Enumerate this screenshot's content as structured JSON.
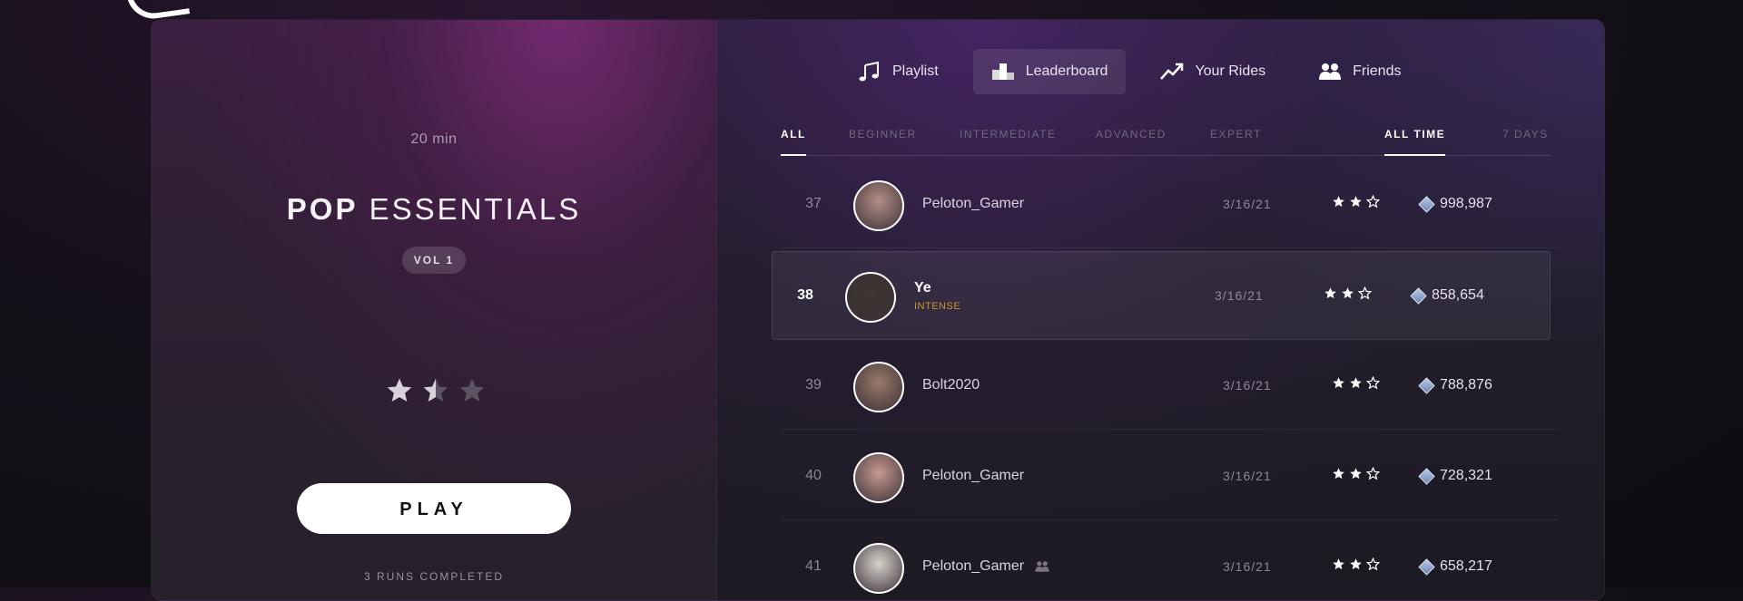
{
  "ride": {
    "duration": "20 min",
    "title_bold": "POP",
    "title_rest": "ESSENTIALS",
    "volume": "VOL 1",
    "difficulty_rating": 1.5,
    "difficulty_max": 3,
    "play_label": "PLAY",
    "runs_completed": "3 RUNS COMPLETED"
  },
  "tabs": [
    {
      "label": "Playlist",
      "icon": "music-note-icon",
      "active": false
    },
    {
      "label": "Leaderboard",
      "icon": "podium-icon",
      "active": true
    },
    {
      "label": "Your Rides",
      "icon": "trending-up-icon",
      "active": false
    },
    {
      "label": "Friends",
      "icon": "friends-icon",
      "active": false
    }
  ],
  "filters": {
    "levels": [
      "ALL",
      "BEGINNER",
      "INTERMEDIATE",
      "ADVANCED",
      "EXPERT"
    ],
    "active_level": "ALL",
    "periods": [
      "ALL TIME",
      "7 DAYS"
    ],
    "active_period": "ALL TIME"
  },
  "leaderboard": [
    {
      "rank": "37",
      "name": "Peloton_Gamer",
      "tag": "",
      "date": "3/16/21",
      "stars": 2,
      "score": "998,987",
      "highlight": false,
      "friend": false,
      "avatar_color": "#b58f86"
    },
    {
      "rank": "38",
      "name": "Ye",
      "tag": "INTENSE",
      "date": "3/16/21",
      "stars": 2,
      "score": "858,654",
      "highlight": true,
      "friend": false,
      "avatar_color": "#3e3530"
    },
    {
      "rank": "39",
      "name": "Bolt2020",
      "tag": "",
      "date": "3/16/21",
      "stars": 2,
      "score": "788,876",
      "highlight": false,
      "friend": false,
      "avatar_color": "#9a7a68"
    },
    {
      "rank": "40",
      "name": "Peloton_Gamer",
      "tag": "",
      "date": "3/16/21",
      "stars": 2,
      "score": "728,321",
      "highlight": false,
      "friend": false,
      "avatar_color": "#c79a8e"
    },
    {
      "rank": "41",
      "name": "Peloton_Gamer",
      "tag": "",
      "date": "3/16/21",
      "stars": 2,
      "score": "658,217",
      "highlight": false,
      "friend": true,
      "avatar_color": "#d8d2cc"
    }
  ],
  "colors": {
    "accent_tag": "#c8962f",
    "star": "#ffffff"
  }
}
